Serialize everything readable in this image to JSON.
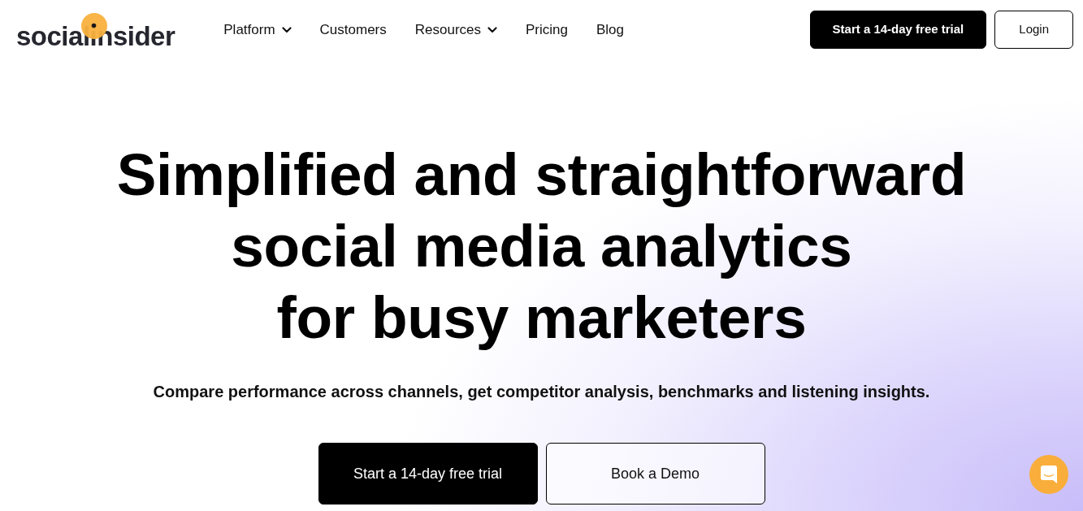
{
  "logo": {
    "text": "socialinsider"
  },
  "nav": [
    {
      "label": "Platform",
      "dropdown": true
    },
    {
      "label": "Customers",
      "dropdown": false
    },
    {
      "label": "Resources",
      "dropdown": true
    },
    {
      "label": "Pricing",
      "dropdown": false
    },
    {
      "label": "Blog",
      "dropdown": false
    }
  ],
  "header_buttons": [
    {
      "label": "Start a 14-day free trial",
      "kind": "primary"
    },
    {
      "label": "Login",
      "kind": "outline"
    }
  ],
  "hero": {
    "headline": [
      "Simplified and straightforward",
      "social media analytics",
      "for busy marketers"
    ],
    "subtitle": "Compare performance across channels, get competitor analysis, benchmarks and listening insights.",
    "buttons": [
      {
        "label": "Start a 14-day free trial",
        "kind": "primary"
      },
      {
        "label": "Book a Demo",
        "kind": "outline"
      }
    ]
  }
}
